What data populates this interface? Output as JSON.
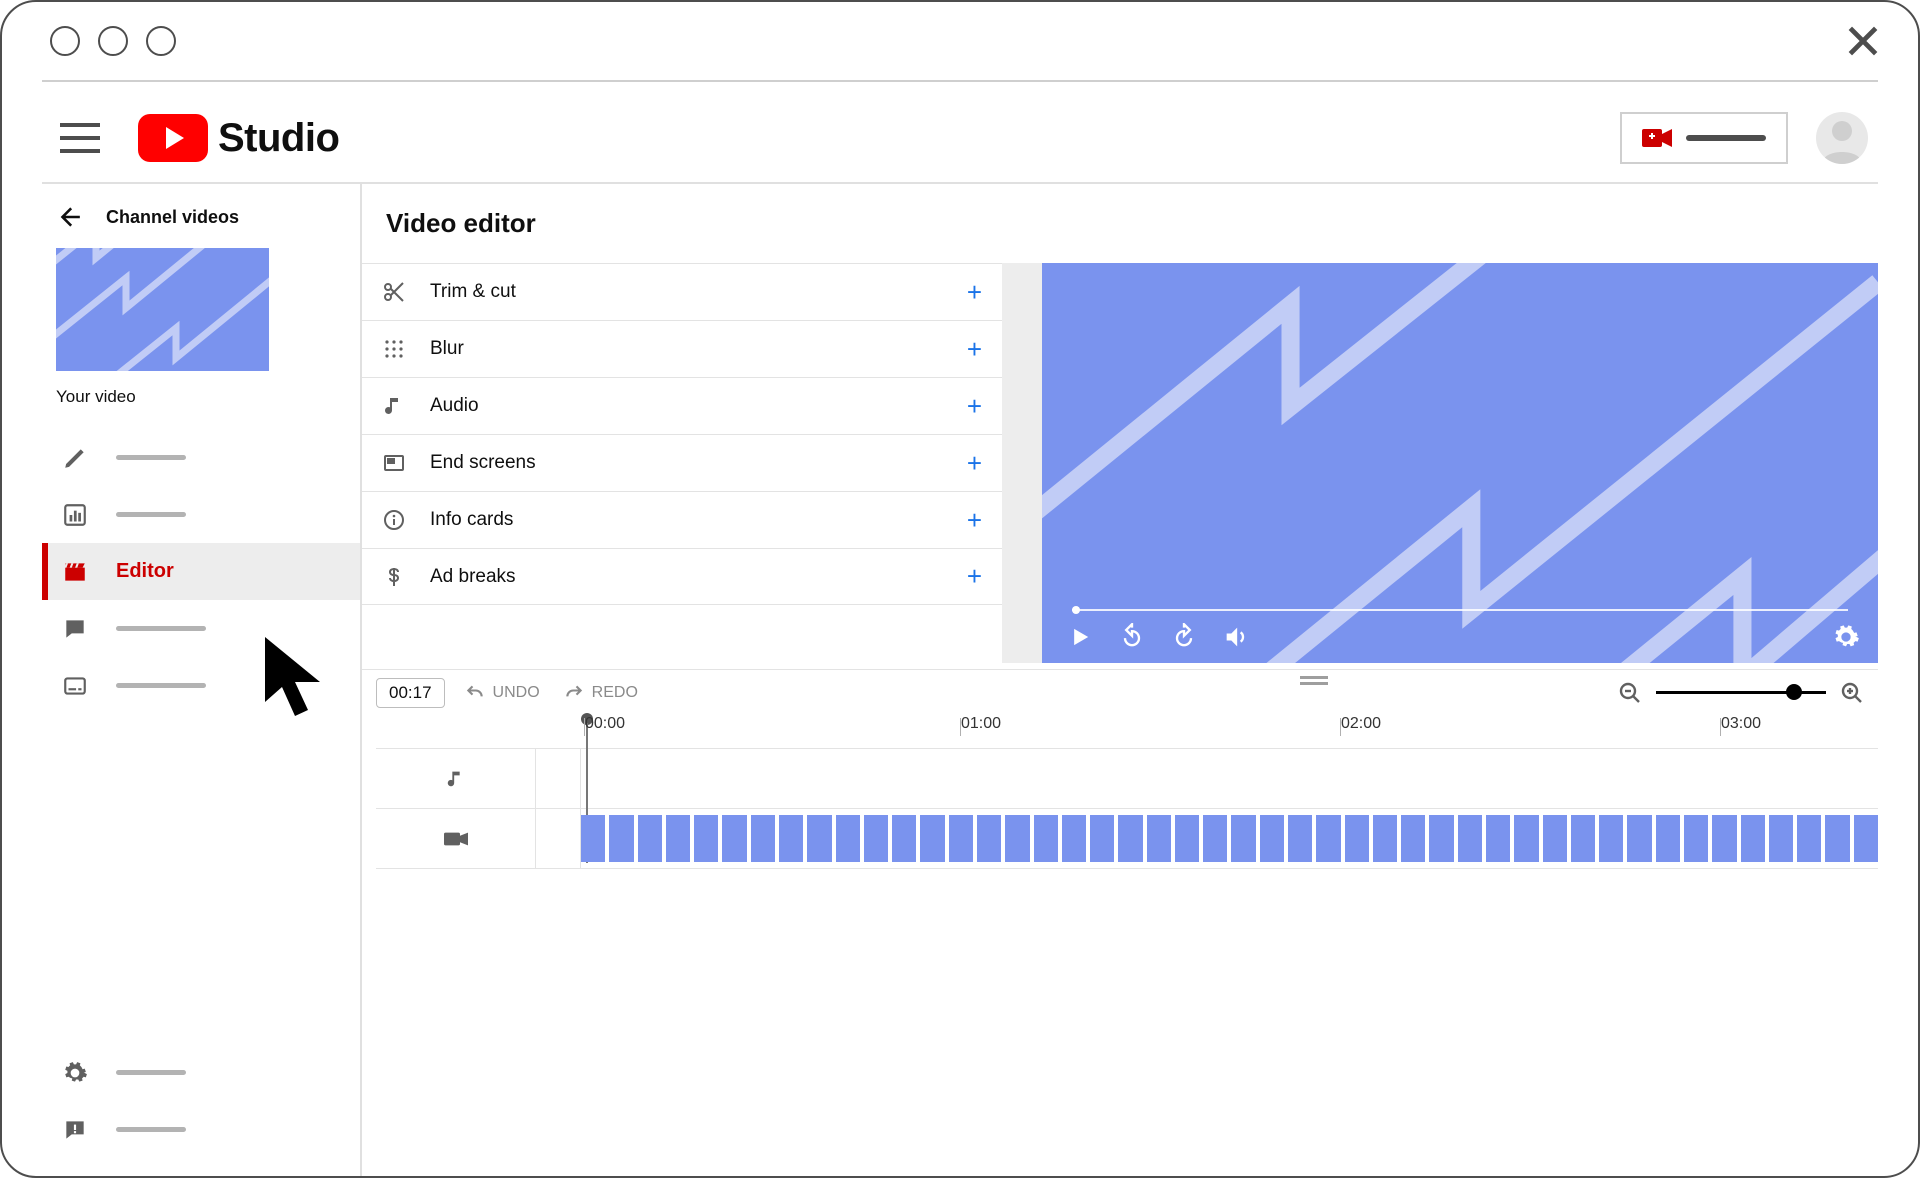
{
  "header": {
    "brand": "Studio"
  },
  "sidebar": {
    "back_label": "Channel videos",
    "your_video_label": "Your video",
    "items": [
      {
        "icon": "pencil"
      },
      {
        "icon": "analytics"
      },
      {
        "icon": "clapper",
        "label": "Editor",
        "active": true
      },
      {
        "icon": "comment"
      },
      {
        "icon": "cc"
      }
    ],
    "footer_items": [
      {
        "icon": "gear"
      },
      {
        "icon": "feedback"
      }
    ]
  },
  "page": {
    "title": "Video editor"
  },
  "tools": [
    {
      "icon": "scissors",
      "label": "Trim & cut"
    },
    {
      "icon": "grid",
      "label": "Blur"
    },
    {
      "icon": "note",
      "label": "Audio"
    },
    {
      "icon": "endscreen",
      "label": "End screens"
    },
    {
      "icon": "info",
      "label": "Info cards"
    },
    {
      "icon": "dollar",
      "label": "Ad breaks"
    }
  ],
  "player": {
    "controls": [
      "play",
      "rewind10",
      "forward10",
      "volume"
    ],
    "settings_icon": "gear"
  },
  "timeline": {
    "timecode": "00:17",
    "undo_label": "UNDO",
    "redo_label": "REDO",
    "ticks": [
      "00:00",
      "01:00",
      "02:00",
      "03:00"
    ],
    "tracks": [
      "audio",
      "video"
    ],
    "zoom_value": 0.82
  },
  "colors": {
    "accent_red": "#ff0000",
    "link_blue": "#1a73e8",
    "clip_fill": "#7a93ee"
  }
}
